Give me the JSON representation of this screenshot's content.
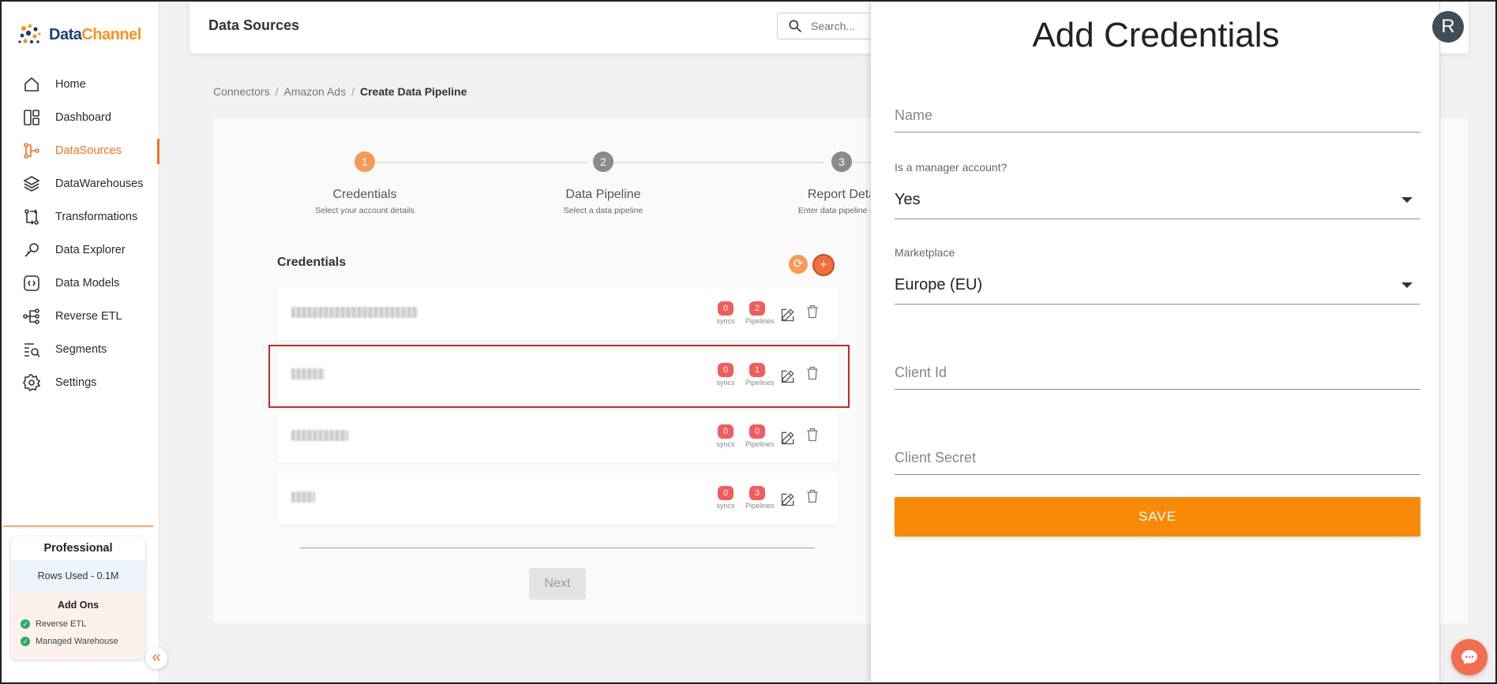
{
  "brand": {
    "name_part1": "Data",
    "name_part2": "Channel"
  },
  "sidebar": {
    "items": [
      {
        "label": "Home",
        "icon": "home-icon"
      },
      {
        "label": "Dashboard",
        "icon": "dashboard-icon"
      },
      {
        "label": "DataSources",
        "icon": "datasources-icon",
        "active": true
      },
      {
        "label": "DataWarehouses",
        "icon": "layers-icon"
      },
      {
        "label": "Transformations",
        "icon": "transform-icon"
      },
      {
        "label": "Data Explorer",
        "icon": "explorer-icon"
      },
      {
        "label": "Data Models",
        "icon": "models-icon"
      },
      {
        "label": "Reverse ETL",
        "icon": "reverse-etl-icon"
      },
      {
        "label": "Segments",
        "icon": "segments-icon"
      },
      {
        "label": "Settings",
        "icon": "gear-icon"
      }
    ],
    "plan": {
      "name": "Professional",
      "rows_used": "Rows Used - 0.1M",
      "addons_title": "Add Ons",
      "addons": [
        "Reverse ETL",
        "Managed Warehouse"
      ]
    },
    "collapse_glyph": "«"
  },
  "header": {
    "title": "Data Sources",
    "search_placeholder": "Search...",
    "avatar_initial": "R"
  },
  "breadcrumb": {
    "items": [
      "Connectors",
      "Amazon Ads",
      "Create Data Pipeline"
    ],
    "separator": "/"
  },
  "stepper": {
    "steps": [
      {
        "number": "1",
        "title": "Credentials",
        "subtitle": "Select your account details",
        "state": "active"
      },
      {
        "number": "2",
        "title": "Data Pipeline",
        "subtitle": "Select a data pipeline",
        "state": "pending"
      },
      {
        "number": "3",
        "title": "Report Deta",
        "subtitle": "Enter data pipeline conf",
        "state": "pending"
      }
    ],
    "colors": {
      "active": "#f79a55",
      "pending": "#8a8a8a"
    }
  },
  "credentials": {
    "heading": "Credentials",
    "refresh_glyph": "⟳",
    "add_glyph": "+",
    "syncs_label": "syncs",
    "pipelines_label": "Pipelines",
    "rows": [
      {
        "syncs": "0",
        "pipelines": "2"
      },
      {
        "syncs": "0",
        "pipelines": "1"
      },
      {
        "syncs": "0",
        "pipelines": "0"
      },
      {
        "syncs": "0",
        "pipelines": "3"
      }
    ],
    "next_label": "Next"
  },
  "panel": {
    "title": "Add Credentials",
    "name_placeholder": "Name",
    "manager_label": "Is a manager account?",
    "manager_value": "Yes",
    "marketplace_label": "Marketplace",
    "marketplace_value": "Europe (EU)",
    "client_id_placeholder": "Client Id",
    "client_secret_placeholder": "Client Secret",
    "save_label": "SAVE"
  },
  "colors": {
    "accent": "#f37320",
    "save": "#f88a07",
    "badge": "#f25c5c"
  }
}
